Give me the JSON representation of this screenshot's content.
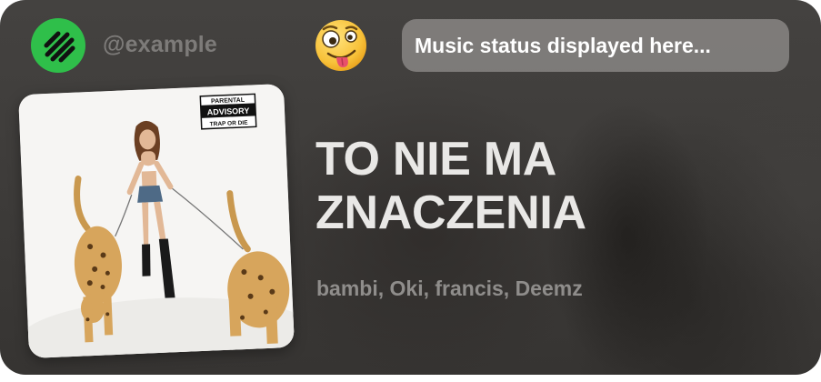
{
  "profile": {
    "username": "@example",
    "emoji": "zany-face"
  },
  "status": {
    "text": "Music status displayed here..."
  },
  "track": {
    "title_line1": "TO NIE MA",
    "title_line2": "ZNACZENIA",
    "artists": "bambi, Oki, francis, Deemz"
  },
  "album_art": {
    "advisory_line1": "PARENTAL",
    "advisory_line2": "ADVISORY",
    "advisory_line3": "TRAP OR DIE"
  },
  "colors": {
    "logo_green": "#2fbf4a",
    "card_bg": "#41403e",
    "title": "#e9e8e6",
    "muted": "#8f8d8b"
  }
}
